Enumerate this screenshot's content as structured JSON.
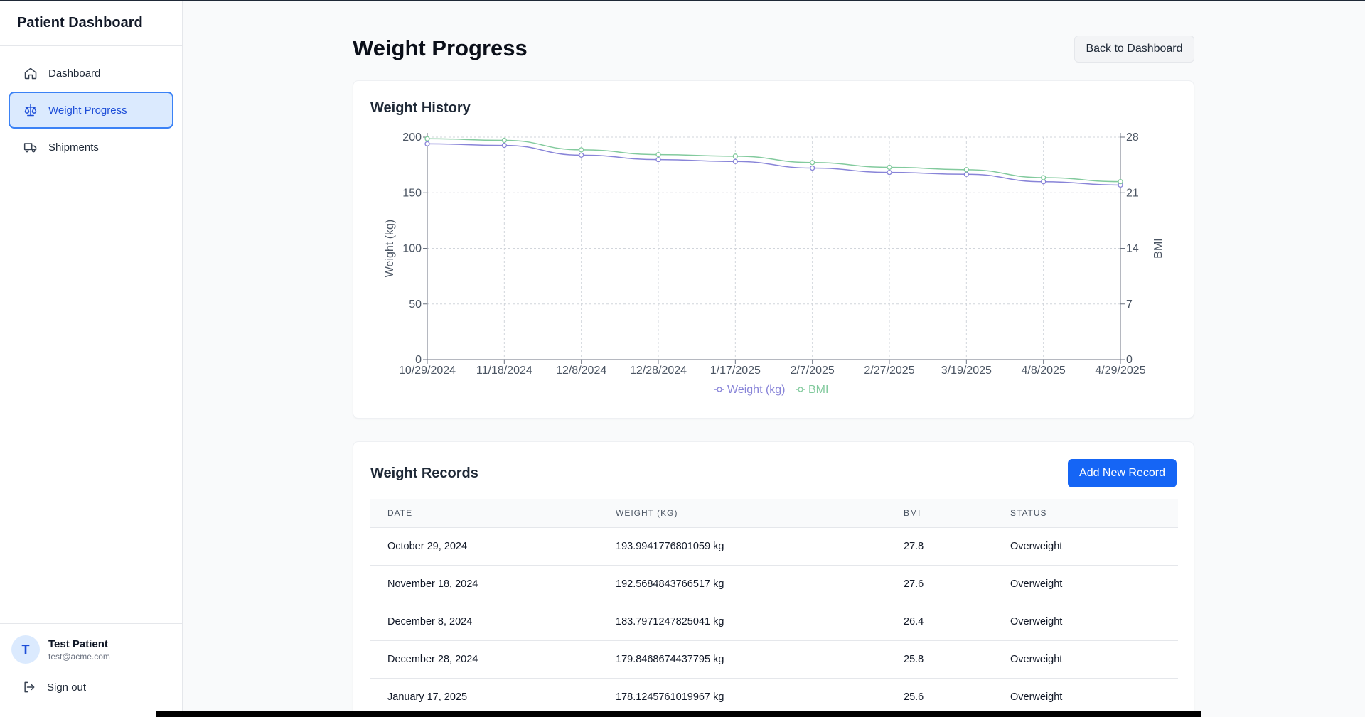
{
  "app": {
    "brand": "Patient Dashboard"
  },
  "sidebar": {
    "items": [
      {
        "label": "Dashboard",
        "icon": "home-icon"
      },
      {
        "label": "Weight Progress",
        "icon": "scale-icon",
        "active": true
      },
      {
        "label": "Shipments",
        "icon": "truck-icon"
      }
    ],
    "user": {
      "initial": "T",
      "name": "Test Patient",
      "email": "test@acme.com"
    },
    "signout_label": "Sign out"
  },
  "main": {
    "title": "Weight Progress",
    "back_label": "Back to Dashboard"
  },
  "chart_card": {
    "title": "Weight History"
  },
  "chart_data": {
    "type": "line",
    "x": [
      "10/29/2024",
      "11/18/2024",
      "12/8/2024",
      "12/28/2024",
      "1/17/2025",
      "2/7/2025",
      "2/27/2025",
      "3/19/2025",
      "4/8/2025",
      "4/29/2025"
    ],
    "series": [
      {
        "name": "Weight (kg)",
        "axis": "left",
        "color": "#8884d8",
        "values": [
          194.0,
          192.6,
          183.8,
          179.8,
          178.1,
          172.2,
          168.3,
          166.6,
          159.9,
          156.9
        ]
      },
      {
        "name": "BMI",
        "axis": "right",
        "color": "#82ca9d",
        "values": [
          27.8,
          27.6,
          26.4,
          25.8,
          25.6,
          24.8,
          24.2,
          23.9,
          22.9,
          22.4
        ]
      }
    ],
    "ylabel": "Weight (kg)",
    "y2label": "BMI",
    "ylim": [
      0,
      200
    ],
    "y2lim": [
      0,
      28
    ],
    "yticks": [
      0,
      50,
      100,
      150,
      200
    ],
    "y2ticks": [
      0,
      7,
      14,
      21,
      28
    ],
    "grid": true,
    "legend": "bottom"
  },
  "records": {
    "title": "Weight Records",
    "add_label": "Add New Record",
    "headers": [
      "DATE",
      "WEIGHT (KG)",
      "BMI",
      "STATUS"
    ],
    "rows": [
      {
        "date": "October 29, 2024",
        "weight": "193.9941776801059 kg",
        "bmi": "27.8",
        "status": "Overweight"
      },
      {
        "date": "November 18, 2024",
        "weight": "192.5684843766517 kg",
        "bmi": "27.6",
        "status": "Overweight"
      },
      {
        "date": "December 8, 2024",
        "weight": "183.7971247825041 kg",
        "bmi": "26.4",
        "status": "Overweight"
      },
      {
        "date": "December 28, 2024",
        "weight": "179.8468674437795 kg",
        "bmi": "25.8",
        "status": "Overweight"
      },
      {
        "date": "January 17, 2025",
        "weight": "178.1245761019967 kg",
        "bmi": "25.6",
        "status": "Overweight"
      }
    ]
  }
}
